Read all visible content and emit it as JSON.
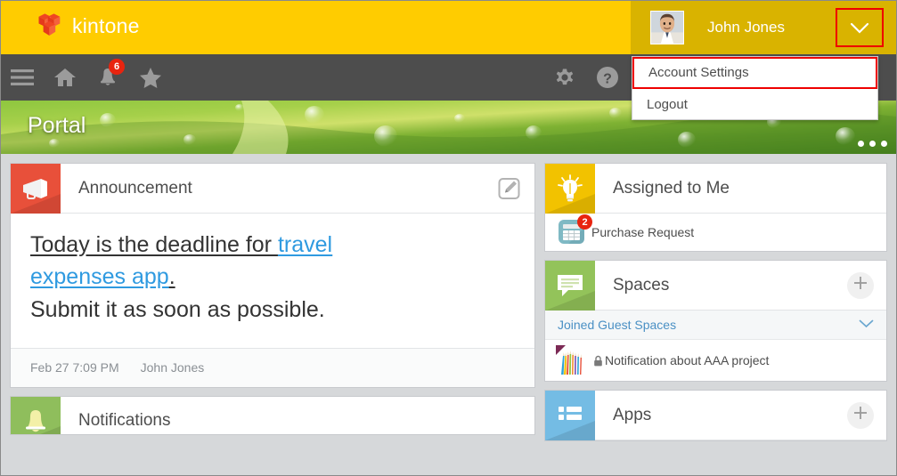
{
  "brand": {
    "name": "kintone",
    "header_color": "#ffcc00",
    "user_area_color": "#d9b300",
    "nav_color": "#4d4d4d",
    "highlight_color": "#ee0000"
  },
  "header": {
    "logo_label": "kintone",
    "user_name": "John Jones",
    "caret_icon": "chevron-down-icon",
    "avatar_icon": "user-avatar"
  },
  "dropdown": {
    "items": [
      {
        "label": "Account Settings",
        "highlighted": true
      },
      {
        "label": "Logout",
        "highlighted": false
      }
    ]
  },
  "nav": {
    "left_items": [
      {
        "icon": "hamburger-menu-icon",
        "label": "Menu",
        "badge": ""
      },
      {
        "icon": "home-icon",
        "label": "Home",
        "badge": ""
      },
      {
        "icon": "bell-icon",
        "label": "Notifications",
        "badge": "6"
      },
      {
        "icon": "star-icon",
        "label": "Favorites",
        "badge": ""
      }
    ],
    "right_items": [
      {
        "icon": "gear-icon",
        "label": "Settings"
      },
      {
        "icon": "help-icon",
        "label": "Help"
      }
    ]
  },
  "banner": {
    "title": "Portal",
    "dots_icon": "more-options-icon",
    "dots_count": 3
  },
  "announcement": {
    "icon": "megaphone-icon",
    "title": "Announcement",
    "edit_icon": "edit-pencil-icon",
    "line1_prefix": "Today is the deadline for ",
    "line1_link": "travel",
    "line2_link": "expenses app",
    "line2_suffix": ".",
    "line3": "Submit it as soon as possible.",
    "timestamp": "Feb 27 7:09 PM",
    "author": "John Jones"
  },
  "notifications": {
    "icon": "bell-icon",
    "title": "Notifications"
  },
  "assigned": {
    "icon": "lightbulb-icon",
    "title": "Assigned to Me",
    "items": [
      {
        "icon": "calculator-app-icon",
        "label": "Purchase Request",
        "badge": "2"
      }
    ]
  },
  "spaces": {
    "icon": "chat-bubble-icon",
    "title": "Spaces",
    "add_icon": "plus-icon",
    "group_label": "Joined Guest Spaces",
    "group_chevron": "chevron-down-icon",
    "items": [
      {
        "thumb": "colored-pencils-thumbnail",
        "lock_icon": "lock-icon",
        "label": "Notification about AAA project"
      }
    ]
  },
  "apps": {
    "icon": "app-list-icon",
    "title": "Apps",
    "add_icon": "plus-icon"
  }
}
